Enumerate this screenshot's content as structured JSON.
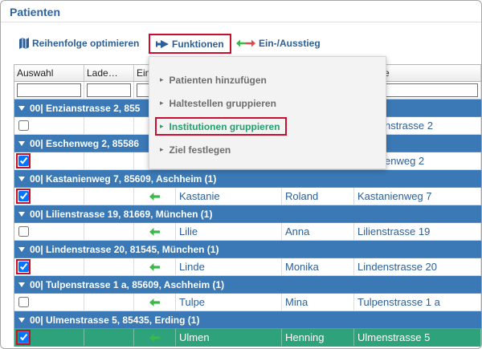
{
  "panel": {
    "title": "Patienten"
  },
  "colors": {
    "accent_blue": "#2c5f98",
    "group_row": "#3b79b6",
    "selected_row": "#2ea27a",
    "arrow_green": "#3cb84a",
    "highlight_red": "#c8102e",
    "menu_active": "#24a06b"
  },
  "toolbar": {
    "optimize": {
      "icon": "map-icon",
      "label": "Reihenfolge optimieren"
    },
    "functions": {
      "icon": "route-icon",
      "label": "Funktionen",
      "highlighted": true
    },
    "boarding": {
      "icon": "left-right-arrows-icon",
      "label": "Ein-/Ausstieg"
    }
  },
  "table": {
    "headers": {
      "select": "Auswahl",
      "load": "Lade…",
      "boarding": "Ein",
      "street": "e"
    },
    "groups": [
      {
        "label": "00| Enzianstrasse 2, 855",
        "expanded": true,
        "row": {
          "checked": false,
          "highlighted": false,
          "selected": false,
          "street": "nstrasse 2"
        }
      },
      {
        "label": "00| Eschenweg 2, 85586",
        "expanded": true,
        "row": {
          "checked": true,
          "highlighted": true,
          "selected": false,
          "street": "enweg 2"
        }
      },
      {
        "label": "00| Kastanienweg 7, 85609, Aschheim (1)",
        "expanded": true,
        "row": {
          "checked": true,
          "highlighted": true,
          "selected": false,
          "boarding_icon": "arrow-left-icon",
          "name": "Kastanie",
          "first_name": "Roland",
          "street": "Kastanienweg 7"
        }
      },
      {
        "label": "00| Lilienstrasse 19, 81669, München (1)",
        "expanded": true,
        "row": {
          "checked": false,
          "highlighted": false,
          "selected": false,
          "boarding_icon": "arrow-left-icon",
          "name": "Lilie",
          "first_name": "Anna",
          "street": "Lilienstrasse 19"
        }
      },
      {
        "label": "00| Lindenstrasse 20, 81545, München (1)",
        "expanded": true,
        "row": {
          "checked": true,
          "highlighted": true,
          "selected": false,
          "boarding_icon": "arrow-left-icon",
          "name": "Linde",
          "first_name": "Monika",
          "street": "Lindenstrasse 20"
        }
      },
      {
        "label": "00| Tulpenstrasse 1 a, 85609, Aschheim (1)",
        "expanded": true,
        "row": {
          "checked": false,
          "highlighted": false,
          "selected": false,
          "boarding_icon": "arrow-left-icon",
          "name": "Tulpe",
          "first_name": "Mina",
          "street": "Tulpenstrasse 1 a"
        }
      },
      {
        "label": "00| Ulmenstrasse 5, 85435, Erding (1)",
        "expanded": true,
        "row": {
          "checked": true,
          "highlighted": true,
          "selected": true,
          "boarding_icon": "arrow-left-icon",
          "name": "Ulmen",
          "first_name": "Henning",
          "street": "Ulmenstrasse 5"
        }
      }
    ]
  },
  "menu": {
    "items": [
      {
        "label": "Patienten hinzufügen",
        "active": false
      },
      {
        "label": "Haltestellen gruppieren",
        "active": false
      },
      {
        "label": "Institutionen gruppieren",
        "active": true
      },
      {
        "label": "Ziel festlegen",
        "active": false
      }
    ]
  }
}
